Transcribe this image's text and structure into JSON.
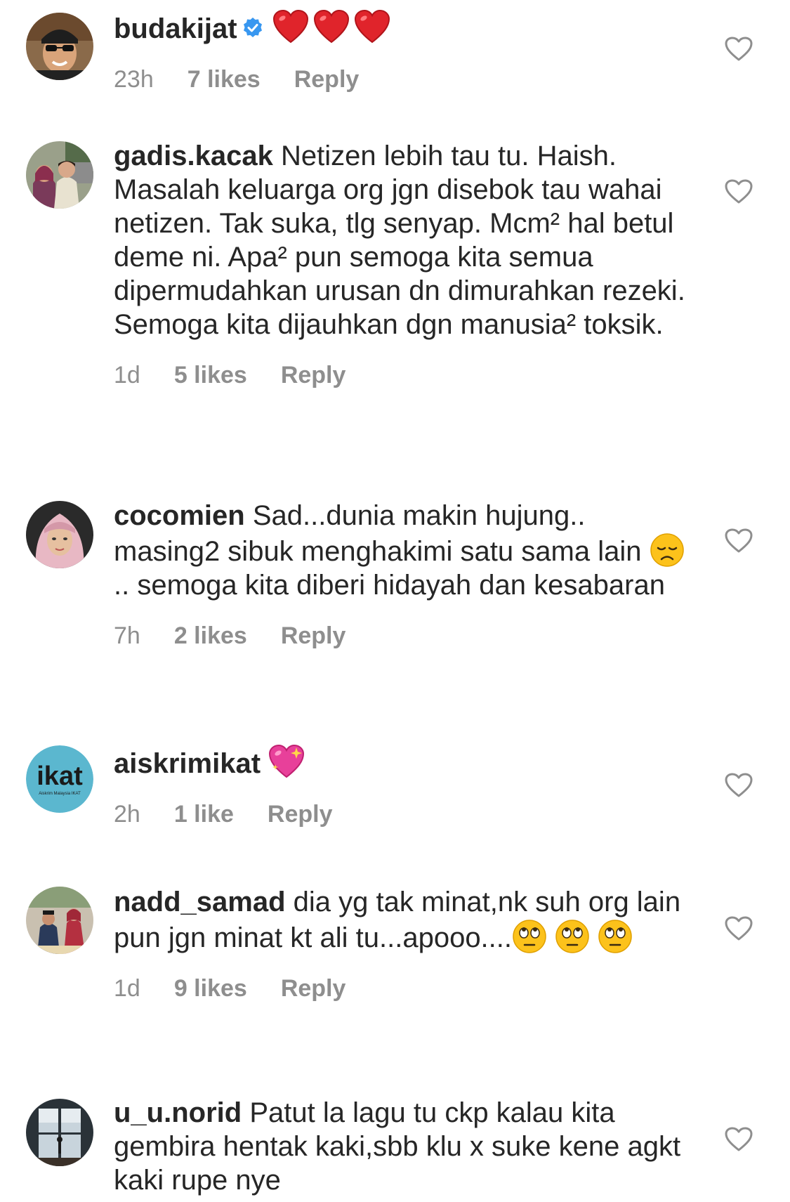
{
  "comments": [
    {
      "username": "budakijat",
      "verified": true,
      "text": "",
      "emoji": [
        "red-heart",
        "red-heart",
        "red-heart"
      ],
      "time": "23h",
      "likes": "7 likes",
      "reply": "Reply"
    },
    {
      "username": "gadis.kacak",
      "text": "Netizen lebih tau tu. Haish. Masalah keluarga org jgn disebok tau wahai netizen. Tak suka, tlg senyap. Mcm² hal betul deme ni. Apa² pun semoga kita semua dipermudahkan urusan dn dimurahkan rezeki. Semoga kita dijauhkan dgn manusia² toksik.",
      "time": "1d",
      "likes": "5 likes",
      "reply": "Reply"
    },
    {
      "username": "cocomien",
      "text_before_emoji": "Sad...dunia makin hujung.. masing2 sibuk menghakimi satu sama lain",
      "emoji": "disappointed-face",
      "text_after_emoji": ".. semoga kita diberi hidayah dan kesabaran",
      "time": "7h",
      "likes": "2 likes",
      "reply": "Reply"
    },
    {
      "username": "aiskrimikat",
      "emoji": "sparkling-heart",
      "avatar_text": "ikat",
      "avatar_subtext": "Aiskrim Malaysia IKAT",
      "time": "2h",
      "likes": "1 like",
      "reply": "Reply"
    },
    {
      "username": "nadd_samad",
      "text": "dia yg tak minat,nk suh org lain pun jgn minat kt ali tu...apooo....",
      "emoji": [
        "eye-roll-face",
        "eye-roll-face",
        "eye-roll-face"
      ],
      "time": "1d",
      "likes": "9 likes",
      "reply": "Reply"
    },
    {
      "username": "u_u.norid",
      "text": "Patut la lagu tu ckp kalau kita gembira hentak kaki,sbb klu x suke kene agkt kaki rupe nye"
    }
  ],
  "colors": {
    "text": "#262626",
    "meta": "#8e8e8e",
    "verified": "#3897f0",
    "heart_outline": "#8e8e8e",
    "ikat_avatar_bg": "#5bb7cf"
  },
  "icons": {
    "like": "heart-outline-icon",
    "verified": "verified-badge-icon"
  }
}
